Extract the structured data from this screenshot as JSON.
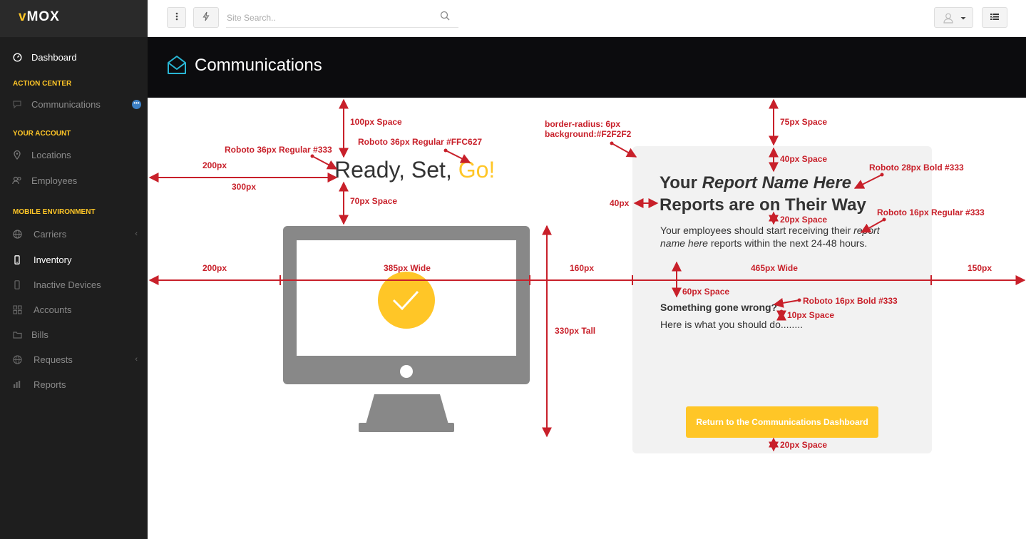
{
  "brand": {
    "logo_prefix": "v",
    "logo_rest": "MOX"
  },
  "sidebar": {
    "dashboard": "Dashboard",
    "section_action": "ACTION CENTER",
    "communications": "Communications",
    "section_account": "YOUR ACCOUNT",
    "locations": "Locations",
    "employees": "Employees",
    "section_mobile": "MOBILE ENVIRONMENT",
    "carriers": "Carriers",
    "inventory": "Inventory",
    "inactive_devices": "Inactive Devices",
    "accounts": "Accounts",
    "bills": "Bills",
    "requests": "Requests",
    "reports": "Reports",
    "badge": "•••"
  },
  "topbar": {
    "search_placeholder": "Site Search.."
  },
  "header": {
    "title": "Communications"
  },
  "main": {
    "headline_prefix": "Ready, Set, ",
    "headline_go": "Go!",
    "card": {
      "your": "Your ",
      "report_name": "Report Name Here",
      "line2": "Reports are on Their Way",
      "body_a": "Your employees should start receiving their ",
      "body_em": "report name here",
      "body_b": " reports within the next 24-48 hours.",
      "something_wrong": "Something gone wrong?",
      "here_is": "Here is what you should do........",
      "button": "Return to the Communications Dashboard"
    }
  },
  "annotations": {
    "a100": "100px Space",
    "a75": "75px Space",
    "font_yellow": "Roboto 36px Regular #FFC627",
    "font_333": "Roboto 36px Regular #333",
    "border1": "border-radius: 6px",
    "border2": "background:#F2F2F2",
    "a40space": "40px Space",
    "font28": "Roboto 28px Bold #333",
    "a200top": "200px",
    "a300": "300px",
    "a40": "40px",
    "a20space1": "20px Space",
    "font16reg": "Roboto 16px Regular #333",
    "a70": "70px Space",
    "a200": "200px",
    "a385": "385px Wide",
    "a160": "160px",
    "a465": "465px Wide",
    "a150": "150px",
    "a60": "60px Space",
    "font16bold": "Roboto 16px Bold #333",
    "a10": "10px Space",
    "a330": "330px Tall",
    "a20space2": "20px Space"
  },
  "colors": {
    "accent": "#FFC627",
    "card_bg": "#F2F2F2",
    "annotation": "#C8202A",
    "monitor": "#888888"
  }
}
